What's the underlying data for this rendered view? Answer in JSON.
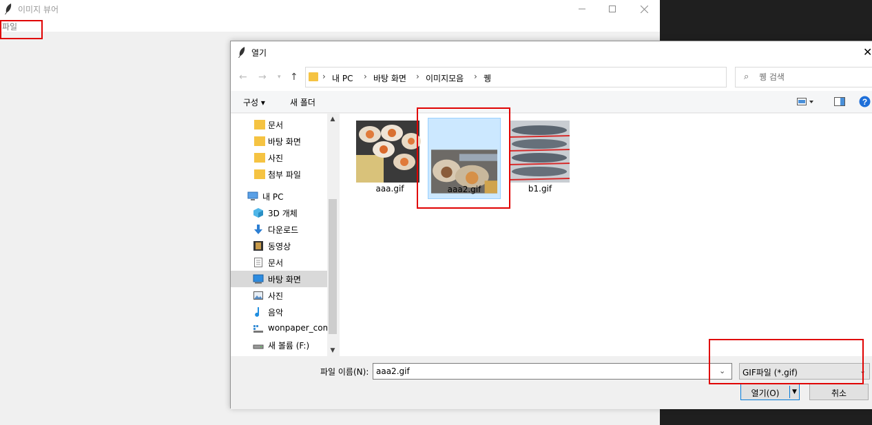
{
  "app": {
    "title": "이미지 뷰어",
    "menu_file": "파일"
  },
  "dialog": {
    "title": "열기",
    "close": "✕",
    "breadcrumb": [
      "내 PC",
      "바탕 화면",
      "이미지모음",
      "퀭"
    ],
    "search_placeholder": "퀭 검색",
    "toolbar": {
      "organize": "구성 ▾",
      "new_folder": "새 폴더"
    },
    "nav_items": [
      {
        "label": "문서",
        "icon": "folder-icon"
      },
      {
        "label": "바탕 화면",
        "icon": "folder-icon"
      },
      {
        "label": "사진",
        "icon": "folder-icon"
      },
      {
        "label": "첨부 파일",
        "icon": "folder-icon"
      },
      {
        "label": "내 PC",
        "icon": "computer-icon"
      },
      {
        "label": "3D 개체",
        "icon": "cube-icon"
      },
      {
        "label": "다운로드",
        "icon": "download-icon"
      },
      {
        "label": "동영상",
        "icon": "video-icon"
      },
      {
        "label": "문서",
        "icon": "document-icon"
      },
      {
        "label": "바탕 화면",
        "icon": "desktop-icon",
        "selected": true
      },
      {
        "label": "사진",
        "icon": "picture-icon"
      },
      {
        "label": "음악",
        "icon": "music-icon"
      },
      {
        "label": "wonpaper_com",
        "icon": "network-icon"
      },
      {
        "label": "새 볼륨 (F:)",
        "icon": "drive-icon"
      }
    ],
    "files": [
      {
        "name": "aaa.gif"
      },
      {
        "name": "aaa2.gif",
        "selected": true
      },
      {
        "name": "b1.gif"
      }
    ],
    "filename_label": "파일 이름(N):",
    "filename_value": "aaa2.gif",
    "filter_value": "GIF파일 (*.gif)",
    "open_label": "열기(O)",
    "cancel_label": "취소"
  },
  "colors": {
    "highlight": "#e00000",
    "selection": "#cce8ff",
    "accent": "#0078d7",
    "help": "#1e6fd9"
  }
}
